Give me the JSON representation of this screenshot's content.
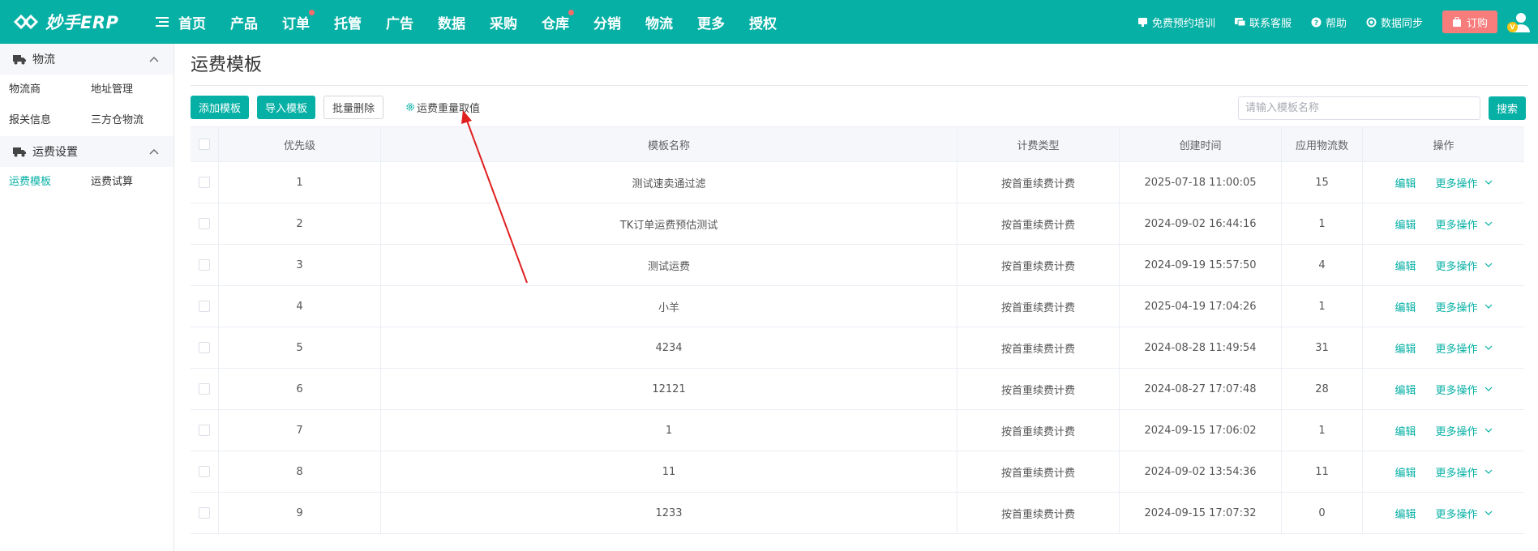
{
  "app": {
    "name": "妙手ERP",
    "nav": [
      {
        "label": "首页",
        "dot": false
      },
      {
        "label": "产品",
        "dot": false
      },
      {
        "label": "订单",
        "dot": true
      },
      {
        "label": "托管",
        "dot": false
      },
      {
        "label": "广告",
        "dot": false
      },
      {
        "label": "数据",
        "dot": false
      },
      {
        "label": "采购",
        "dot": false
      },
      {
        "label": "仓库",
        "dot": true
      },
      {
        "label": "分销",
        "dot": false
      },
      {
        "label": "物流",
        "dot": false
      },
      {
        "label": "更多",
        "dot": false
      },
      {
        "label": "授权",
        "dot": false
      }
    ],
    "top_right": {
      "training": "免费预约培训",
      "support": "联系客服",
      "help": "帮助",
      "sync": "数据同步",
      "order": "订购",
      "avatar_badge": "V"
    },
    "colors": {
      "brand": "#06b0a5",
      "order_button": "#f77c7c",
      "dot": "#f56c6c",
      "annotation": "#e02020"
    }
  },
  "sidebar": {
    "group1": {
      "label": "物流",
      "icon": "truck-icon"
    },
    "group1_links": [
      "物流商",
      "地址管理",
      "报关信息",
      "三方仓物流"
    ],
    "group2": {
      "label": "运费设置",
      "icon": "truck-icon"
    },
    "group2_links": [
      "运费模板",
      "运费试算"
    ],
    "active": "运费模板"
  },
  "main": {
    "title": "运费模板",
    "toolbar": {
      "add": "添加模板",
      "import": "导入模板",
      "batch_delete": "批量删除",
      "weight_setting": "运费重量取值",
      "search_placeholder": "请输入模板名称",
      "search": "搜索"
    },
    "table": {
      "headers": {
        "priority": "优先级",
        "name": "模板名称",
        "type": "计费类型",
        "created": "创建时间",
        "count": "应用物流数",
        "ops": "操作"
      },
      "rows": [
        {
          "priority": "1",
          "name": "测试速卖通过滤",
          "type": "按首重续费计费",
          "created": "2025-07-18 11:00:05",
          "count": "15"
        },
        {
          "priority": "2",
          "name": "TK订单运费预估测试",
          "type": "按首重续费计费",
          "created": "2024-09-02 16:44:16",
          "count": "1"
        },
        {
          "priority": "3",
          "name": "测试运费",
          "type": "按首重续费计费",
          "created": "2024-09-19 15:57:50",
          "count": "4"
        },
        {
          "priority": "4",
          "name": "小羊",
          "type": "按首重续费计费",
          "created": "2025-04-19 17:04:26",
          "count": "1"
        },
        {
          "priority": "5",
          "name": "4234",
          "type": "按首重续费计费",
          "created": "2024-08-28 11:49:54",
          "count": "31"
        },
        {
          "priority": "6",
          "name": "12121",
          "type": "按首重续费计费",
          "created": "2024-08-27 17:07:48",
          "count": "28"
        },
        {
          "priority": "7",
          "name": "1",
          "type": "按首重续费计费",
          "created": "2024-09-15 17:06:02",
          "count": "1"
        },
        {
          "priority": "8",
          "name": "11",
          "type": "按首重续费计费",
          "created": "2024-09-02 13:54:36",
          "count": "11"
        },
        {
          "priority": "9",
          "name": "1233",
          "type": "按首重续费计费",
          "created": "2024-09-15 17:07:32",
          "count": "0"
        }
      ],
      "op_edit": "编辑",
      "op_more": "更多操作"
    }
  }
}
